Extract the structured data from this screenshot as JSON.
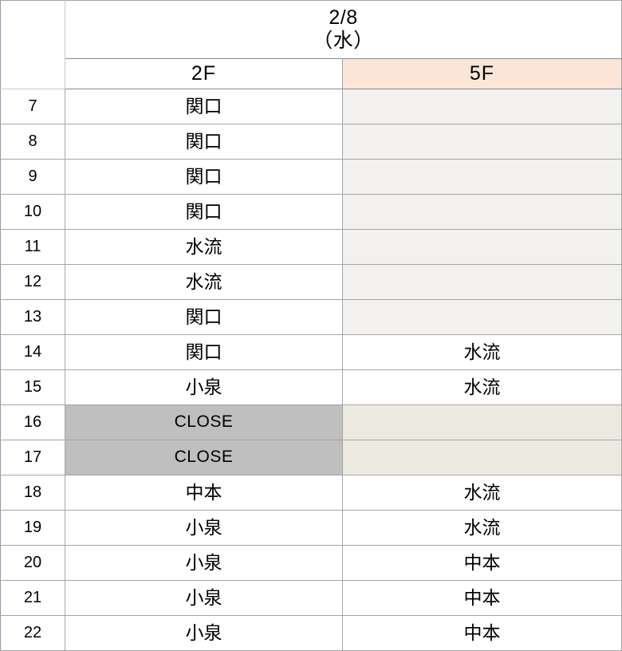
{
  "header": {
    "date_label": "2/8",
    "weekday_label": "（水）",
    "blank_corner": "",
    "floors": [
      {
        "label": "2F",
        "accent": "#ffffff"
      },
      {
        "label": "5F",
        "accent": "#fae5d6"
      }
    ]
  },
  "legend": {
    "closed_label": "CLOSE",
    "hour_column_color": "#faedc8",
    "empty_cell_color": "#f2f1ef",
    "empty_warm_cell_color": "#ece9e0",
    "closed_cell_color": "#bfbfbf"
  },
  "rows": [
    {
      "hour": "7",
      "f2": "関口",
      "f5": "",
      "f2_state": "name",
      "f5_state": "empty"
    },
    {
      "hour": "8",
      "f2": "関口",
      "f5": "",
      "f2_state": "name",
      "f5_state": "empty"
    },
    {
      "hour": "9",
      "f2": "関口",
      "f5": "",
      "f2_state": "name",
      "f5_state": "empty"
    },
    {
      "hour": "10",
      "f2": "関口",
      "f5": "",
      "f2_state": "name",
      "f5_state": "empty"
    },
    {
      "hour": "11",
      "f2": "水流",
      "f5": "",
      "f2_state": "name",
      "f5_state": "empty"
    },
    {
      "hour": "12",
      "f2": "水流",
      "f5": "",
      "f2_state": "name",
      "f5_state": "empty"
    },
    {
      "hour": "13",
      "f2": "関口",
      "f5": "",
      "f2_state": "name",
      "f5_state": "empty"
    },
    {
      "hour": "14",
      "f2": "関口",
      "f5": "水流",
      "f2_state": "name",
      "f5_state": "name"
    },
    {
      "hour": "15",
      "f2": "小泉",
      "f5": "水流",
      "f2_state": "name",
      "f5_state": "name"
    },
    {
      "hour": "16",
      "f2": "CLOSE",
      "f5": "",
      "f2_state": "closed",
      "f5_state": "empty-warm"
    },
    {
      "hour": "17",
      "f2": "CLOSE",
      "f5": "",
      "f2_state": "closed",
      "f5_state": "empty-warm"
    },
    {
      "hour": "18",
      "f2": "中本",
      "f5": "水流",
      "f2_state": "name",
      "f5_state": "name"
    },
    {
      "hour": "19",
      "f2": "小泉",
      "f5": "水流",
      "f2_state": "name",
      "f5_state": "name"
    },
    {
      "hour": "20",
      "f2": "小泉",
      "f5": "中本",
      "f2_state": "name",
      "f5_state": "name"
    },
    {
      "hour": "21",
      "f2": "小泉",
      "f5": "中本",
      "f2_state": "name",
      "f5_state": "name"
    },
    {
      "hour": "22",
      "f2": "小泉",
      "f5": "中本",
      "f2_state": "name",
      "f5_state": "name"
    }
  ]
}
